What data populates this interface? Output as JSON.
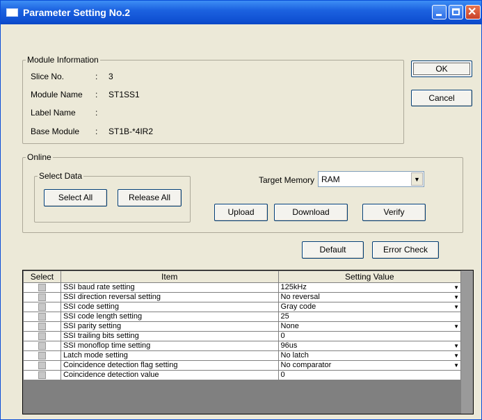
{
  "window": {
    "title": "Parameter Setting No.2"
  },
  "module_info": {
    "legend": "Module Information",
    "fields": [
      {
        "label": "Slice No.",
        "sep": ":",
        "value": "3"
      },
      {
        "label": "Module Name",
        "sep": ":",
        "value": "ST1SS1"
      },
      {
        "label": "Label Name",
        "sep": ":",
        "value": ""
      },
      {
        "label": "Base Module",
        "sep": ":",
        "value": "ST1B-*4IR2"
      }
    ]
  },
  "buttons": {
    "ok": "OK",
    "cancel": "Cancel",
    "select_all": "Select All",
    "release_all": "Release All",
    "upload": "Upload",
    "download": "Download",
    "verify": "Verify",
    "default": "Default",
    "error_check": "Error Check"
  },
  "online": {
    "legend": "Online",
    "select_data_legend": "Select Data",
    "target_memory_label": "Target Memory",
    "target_memory_value": "RAM"
  },
  "table": {
    "headers": [
      "Select",
      "Item",
      "Setting Value"
    ],
    "rows": [
      {
        "item": "SSI baud rate setting",
        "value": "125kHz",
        "dropdown": true
      },
      {
        "item": "SSI direction reversal setting",
        "value": "No reversal",
        "dropdown": true
      },
      {
        "item": "SSI code setting",
        "value": "Gray code",
        "dropdown": true
      },
      {
        "item": "SSI code length setting",
        "value": "25",
        "dropdown": false
      },
      {
        "item": "SSI parity setting",
        "value": "None",
        "dropdown": true
      },
      {
        "item": "SSI trailing bits setting",
        "value": "0",
        "dropdown": false
      },
      {
        "item": "SSI monoflop time setting",
        "value": "96us",
        "dropdown": true
      },
      {
        "item": "Latch mode setting",
        "value": "No latch",
        "dropdown": true
      },
      {
        "item": "Coincidence detection flag setting",
        "value": "No comparator",
        "dropdown": true
      },
      {
        "item": "Coincidence detection value",
        "value": "0",
        "dropdown": false
      }
    ]
  },
  "colors": {
    "titlebar": "#0f50d2",
    "dialog_bg": "#ece9d8",
    "checkbox": "#c8c8c8"
  },
  "icons": {
    "dropdown": "triangle-down",
    "window_icon": "window-icon"
  }
}
